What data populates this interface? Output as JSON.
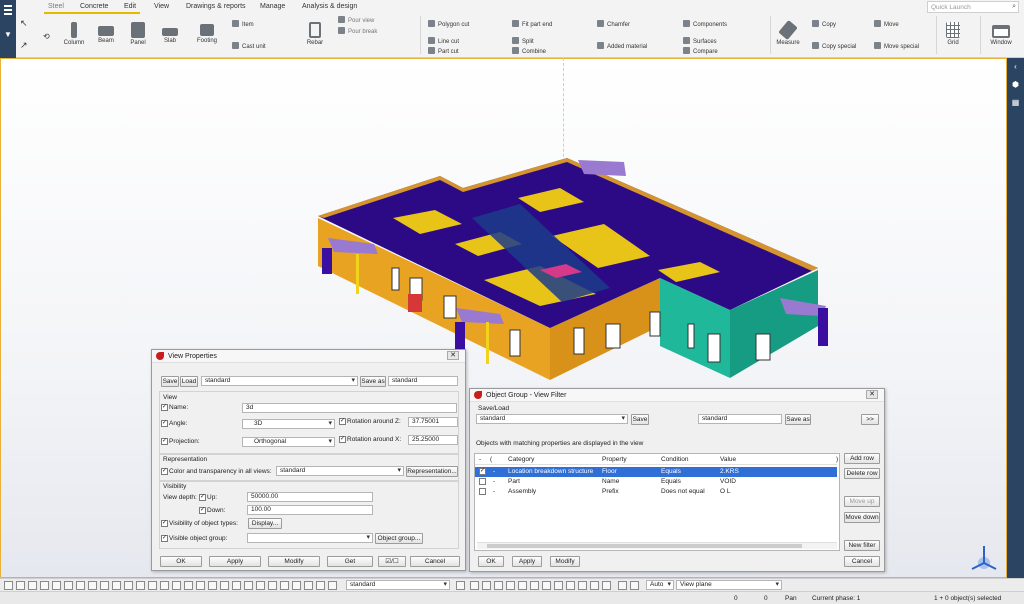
{
  "ribbon": {
    "tabs": [
      "Steel",
      "Concrete",
      "Edit",
      "View",
      "Drawings & reports",
      "Manage",
      "Analysis & design"
    ],
    "quick_launch_placeholder": "Quick Launch",
    "big_buttons": [
      "Column",
      "Beam",
      "Panel",
      "Slab",
      "Footing",
      "Rebar",
      "Measure",
      "Grid",
      "Window"
    ],
    "cmds": {
      "item": "Item",
      "cast_unit": "Cast unit",
      "pour_view": "Pour view",
      "pour_break": "Pour break",
      "polygon_cut": "Polygon cut",
      "line_cut": "Line cut",
      "part_cut": "Part cut",
      "fit_part_end": "Fit part end",
      "split": "Split",
      "combine": "Combine",
      "chamfer": "Chamfer",
      "added_material": "Added material",
      "components": "Components",
      "surfaces": "Surfaces",
      "compare": "Compare",
      "copy": "Copy",
      "copy_special": "Copy special",
      "move": "Move",
      "move_special": "Move special"
    }
  },
  "view_properties": {
    "title": "View Properties",
    "save": "Save",
    "load": "Load",
    "load_value": "standard",
    "save_as": "Save as",
    "save_as_value": "standard",
    "view_group": "View",
    "name_label": "Name:",
    "name_value": "3d",
    "angle_label": "Angle:",
    "angle_value": "3D",
    "rot_z_label": "Rotation around Z:",
    "rot_z_value": "37.75001",
    "projection_label": "Projection:",
    "projection_value": "Orthogonal",
    "rot_x_label": "Rotation around X:",
    "rot_x_value": "25.25000",
    "representation_group": "Representation",
    "color_label": "Color and transparency in all views:",
    "color_value": "standard",
    "representation_btn": "Representation...",
    "visibility_group": "Visibility",
    "view_depth_label": "View depth:",
    "up_label": "Up:",
    "up_value": "50000.00",
    "down_label": "Down:",
    "down_value": "100.00",
    "vis_types_label": "Visibility of object types:",
    "display_btn": "Display...",
    "vis_group_label": "Visible object group:",
    "object_group_btn": "Object group...",
    "buttons": [
      "OK",
      "Apply",
      "Modify",
      "Get",
      "Cancel"
    ]
  },
  "object_group": {
    "title": "Object Group - View Filter",
    "save_load": "Save/Load",
    "preset": "standard",
    "save": "Save",
    "save_as_value": "standard",
    "save_as": "Save as",
    "more": ">>",
    "info": "Objects with matching properties are displayed in the view",
    "columns": [
      "-",
      "(",
      "Category",
      "Property",
      "Condition",
      "Value",
      ")"
    ],
    "rows": [
      {
        "checked": true,
        "dash": "-",
        "category": "Location breakdown structure",
        "property": "Floor",
        "condition": "Equals",
        "value": "2.KRS"
      },
      {
        "checked": false,
        "dash": "-",
        "category": "Part",
        "property": "Name",
        "condition": "Equals",
        "value": "VOID"
      },
      {
        "checked": false,
        "dash": "-",
        "category": "Assembly",
        "property": "Prefix",
        "condition": "Does not equal",
        "value": "O L"
      }
    ],
    "side_buttons": [
      "Add row",
      "Delete row",
      "Move up",
      "Move down",
      "New filter"
    ],
    "buttons": [
      "OK",
      "Apply",
      "Modify",
      "Cancel"
    ]
  },
  "status": {
    "selector_value": "standard",
    "snap_mode": "Auto",
    "plane": "View plane",
    "coord_x": "0",
    "coord_y": "0",
    "mode": "Pan",
    "phase": "Current phase: 1",
    "selection": "1 + 0 object(s) selected"
  },
  "colors": {
    "accent": "#e6b800",
    "nav": "#2a4462",
    "selection": "#2f6fd6",
    "roof": "#2c0a86",
    "wall": "#e8a322",
    "teal": "#1fb89a"
  }
}
